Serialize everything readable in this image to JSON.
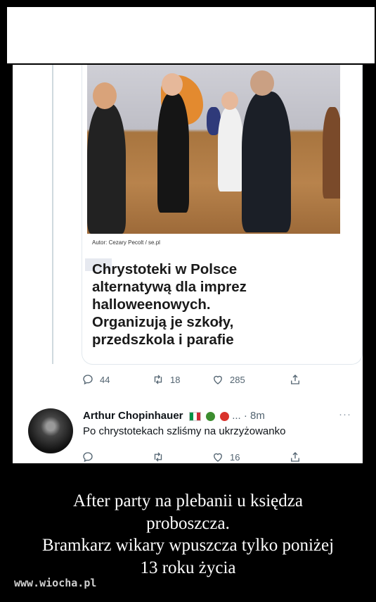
{
  "post": {
    "photo_credit": "Autor: Cezary Pecolt / se.pl",
    "headline_lines": [
      "Chrystoteki w Polsce",
      "alternatywą dla imprez",
      "halloweenowych.",
      "Organizują je szkoły,",
      "przedszkola i parafie"
    ],
    "stats": {
      "replies": "44",
      "retweets": "18",
      "likes": "285"
    }
  },
  "reply": {
    "author": "Arthur Chopinhauer",
    "emojis": [
      "flag-italy",
      "broccoli",
      "tomato"
    ],
    "time": "... · 8m",
    "more": "···",
    "text": "Po chrystotekach szliśmy na ukrzyżowanko",
    "stats": {
      "likes": "16"
    }
  },
  "caption_lines": [
    "After party na plebanii u księdza",
    "proboszcza.",
    "Bramkarz wikary wpuszcza tylko poniżej",
    "13 roku życia"
  ],
  "watermark": "www.wiocha.pl",
  "colors": {
    "background": "#000000",
    "icon_gray": "#536471",
    "text_dark": "#0f1419"
  }
}
